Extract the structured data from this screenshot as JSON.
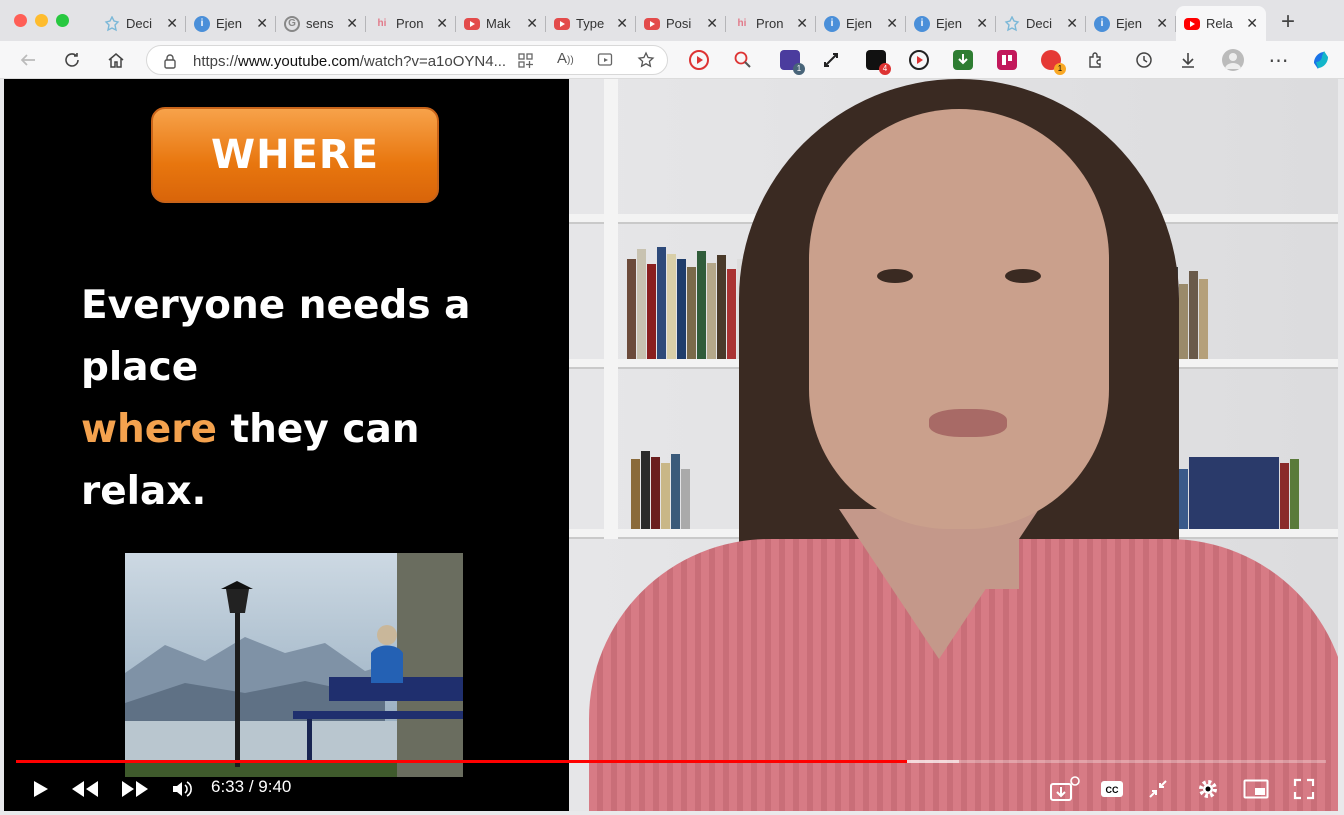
{
  "browser": {
    "tabs": [
      {
        "title": "Deci",
        "favicon": "puzzle",
        "color": "#7bb8d8"
      },
      {
        "title": "Ejen",
        "favicon": "info",
        "color": "#4a8fd9"
      },
      {
        "title": "sens",
        "favicon": "google",
        "color": "#888888"
      },
      {
        "title": "Pron",
        "favicon": "hi",
        "color": "#e17a8a"
      },
      {
        "title": "Mak",
        "favicon": "youtube",
        "color": "#e34b4b"
      },
      {
        "title": "Type",
        "favicon": "youtube",
        "color": "#e34b4b"
      },
      {
        "title": "Posi",
        "favicon": "youtube",
        "color": "#e34b4b"
      },
      {
        "title": "Pron",
        "favicon": "hi",
        "color": "#e17a8a"
      },
      {
        "title": "Ejen",
        "favicon": "info",
        "color": "#4a8fd9"
      },
      {
        "title": "Ejen",
        "favicon": "info",
        "color": "#4a8fd9"
      },
      {
        "title": "Deci",
        "favicon": "puzzle",
        "color": "#7bb8d8"
      },
      {
        "title": "Ejen",
        "favicon": "info",
        "color": "#4a8fd9"
      },
      {
        "title": "Rela",
        "favicon": "youtube",
        "color": "#ff0000",
        "active": true
      }
    ],
    "url_prefix": "https://",
    "url_domain": "www.youtube.com",
    "url_path": "/watch?v=a1oOYN4...",
    "extension_badges": {
      "b1": "1",
      "b2": "4",
      "b3": "1"
    }
  },
  "video": {
    "slide": {
      "button_label": "WHERE",
      "sentence_line1": "Everyone needs a place",
      "sentence_highlight": "where",
      "sentence_line2_rest": " they can relax."
    },
    "time_current": "6:33",
    "time_separator": " / ",
    "time_total": "9:40",
    "progress_played": 0.68,
    "progress_loaded": 0.72
  },
  "colors": {
    "progress_red": "#ff0000",
    "slide_orange": "#e8760e",
    "highlight_orange": "#f4a24e"
  }
}
